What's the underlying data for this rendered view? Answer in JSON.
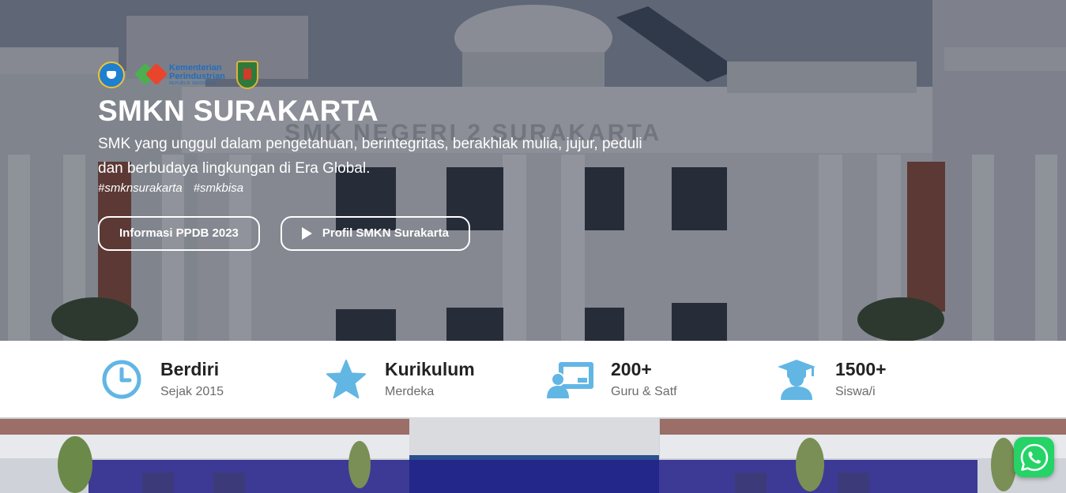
{
  "hero": {
    "logos": [
      {
        "name": "kemdikbud-logo"
      },
      {
        "name": "kemenperin-logo",
        "line1": "Kementerian",
        "line2": "Perindustrian",
        "line3": "REPUBLIK INDONESIA"
      },
      {
        "name": "surakarta-logo"
      }
    ],
    "background_sign": "SMK NEGERI 2 SURAKARTA",
    "title": "SMKN SURAKARTA",
    "tagline": "SMK yang unggul dalam pengetahuan, berintegritas, berakhlak mulia, jujur, peduli dan berbudaya lingkungan di Era Global.",
    "hashtags": [
      "#smknsurakarta",
      "#smkbisa"
    ],
    "buttons": {
      "ppdb": "Informasi PPDB 2023",
      "profile": "Profil SMKN Surakarta"
    }
  },
  "stats": [
    {
      "icon": "clock-icon",
      "value": "Berdiri",
      "label": "Sejak 2015"
    },
    {
      "icon": "star-icon",
      "value": "Kurikulum",
      "label": "Merdeka"
    },
    {
      "icon": "teacher-board-icon",
      "value": "200+",
      "label": "Guru & Satf"
    },
    {
      "icon": "graduate-icon",
      "value": "1500+",
      "label": "Siswa/i"
    }
  ],
  "colors": {
    "accent_icon": "#62b6e4",
    "whatsapp": "#25d366",
    "text_dark": "#222222",
    "text_muted": "#6b6b6b"
  },
  "floating": {
    "whatsapp_icon": "whatsapp-icon"
  }
}
